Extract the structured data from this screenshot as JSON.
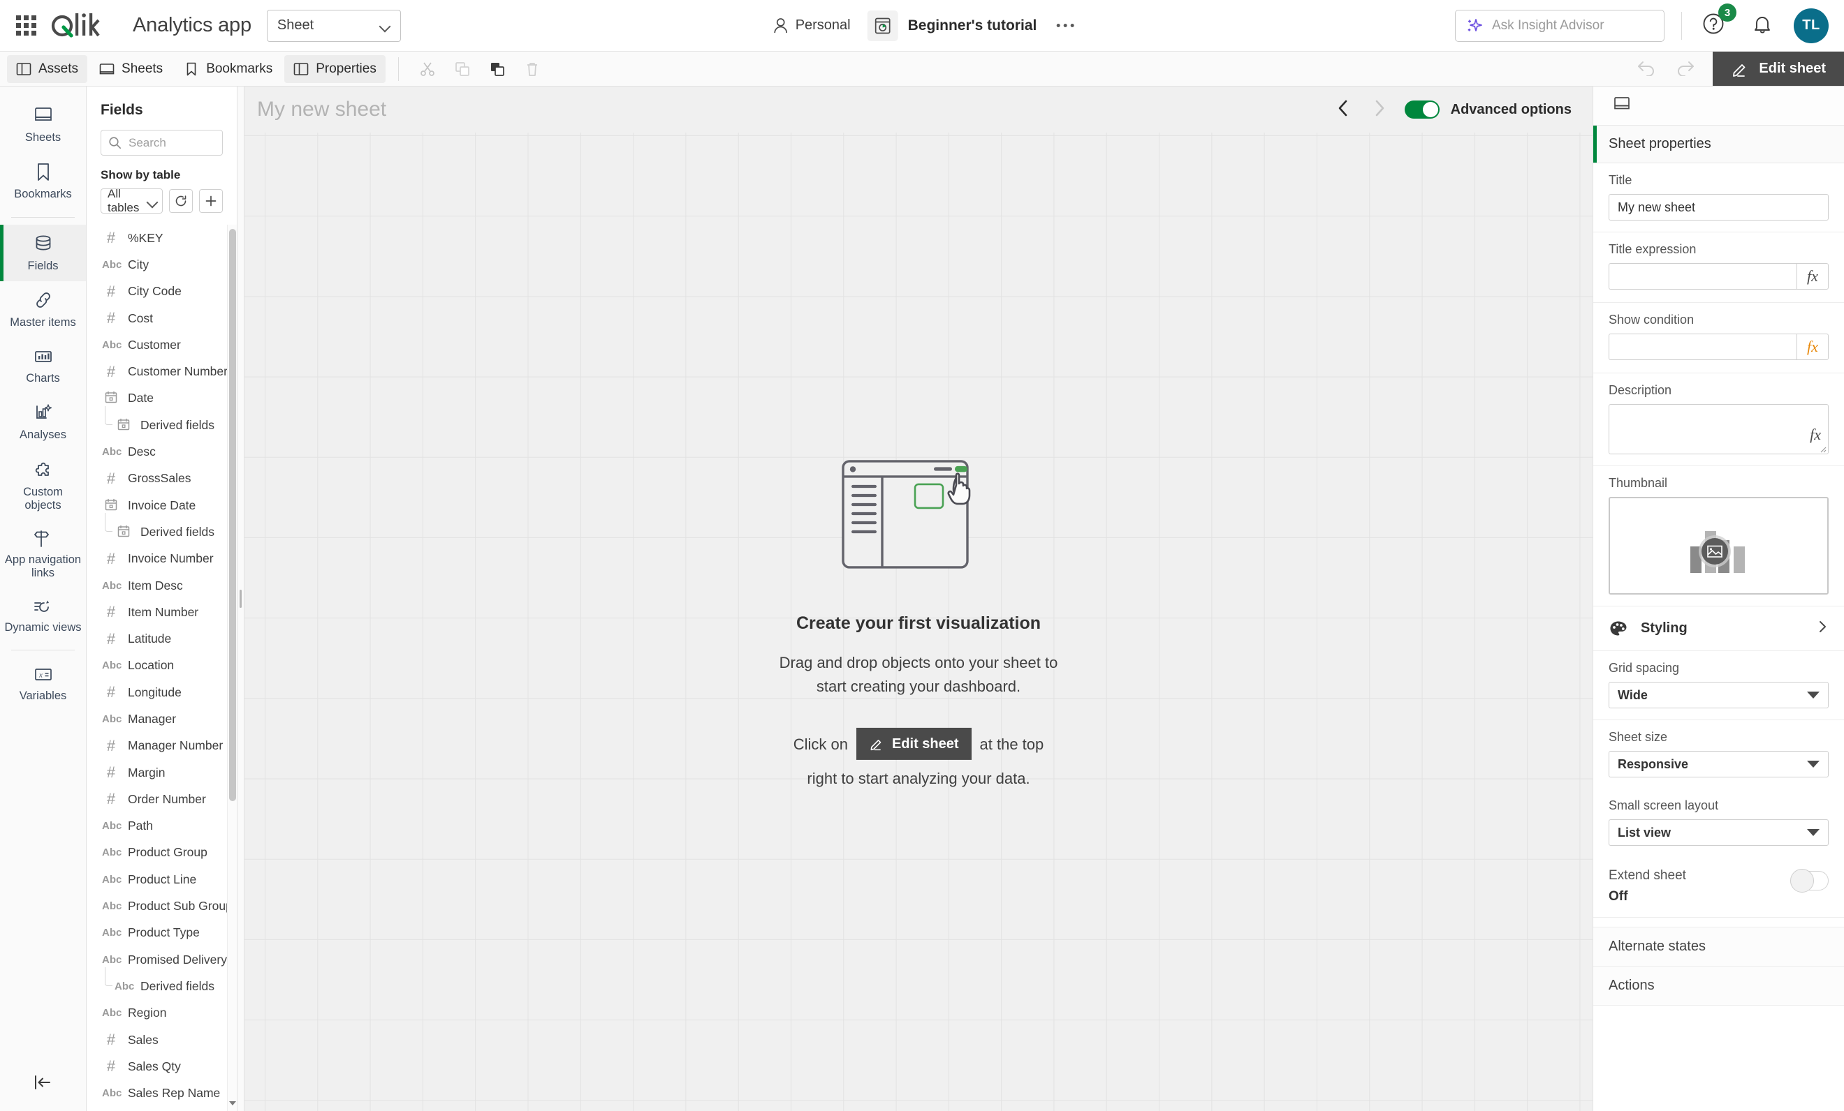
{
  "header": {
    "waffle_icon": "apps-grid-icon",
    "logo_text": "Qlik",
    "app_title": "Analytics app",
    "sheet_selector": {
      "value": "Sheet",
      "chevron": "chevron-down-icon"
    },
    "personal": {
      "label": "Personal",
      "icon": "person-icon"
    },
    "space": {
      "label": "Beginner's tutorial",
      "icon": "app-icon"
    },
    "overflow": "more-options-icon",
    "insight": {
      "placeholder": "Ask Insight Advisor",
      "icon": "sparkle-icon"
    },
    "help": {
      "icon": "help-circle-icon",
      "badge": "3"
    },
    "notifications": {
      "icon": "bell-icon"
    },
    "avatar": {
      "initials": "TL",
      "color": "#0a6e8a"
    }
  },
  "toolbar": {
    "buttons": [
      {
        "label": "Assets",
        "icon": "panel-left-icon",
        "active": true
      },
      {
        "label": "Sheets",
        "icon": "sheet-icon",
        "active": false
      },
      {
        "label": "Bookmarks",
        "icon": "bookmark-icon",
        "active": false
      },
      {
        "label": "Properties",
        "icon": "panel-right-icon",
        "active": true
      }
    ],
    "icon_buttons": [
      "cut-icon",
      "copy-icon",
      "paste-icon",
      "trash-icon"
    ],
    "undo": "undo-icon",
    "redo": "redo-icon",
    "edit_sheet": {
      "label": "Edit sheet",
      "icon": "pencil-icon"
    }
  },
  "rail": {
    "items": [
      {
        "label": "Sheets",
        "icon": "sheet-icon",
        "active": false
      },
      {
        "label": "Bookmarks",
        "icon": "bookmark-icon",
        "active": false
      },
      {
        "label": "Fields",
        "icon": "database-icon",
        "active": true
      },
      {
        "label": "Master items",
        "icon": "link-icon",
        "active": false
      },
      {
        "label": "Charts",
        "icon": "bar-chart-icon",
        "active": false
      },
      {
        "label": "Analyses",
        "icon": "analyses-icon",
        "active": false
      },
      {
        "label": "Custom objects",
        "icon": "puzzle-icon",
        "active": false
      },
      {
        "label": "App navigation links",
        "icon": "flag-icon",
        "active": false
      },
      {
        "label": "Dynamic views",
        "icon": "dynamic-views-icon",
        "active": false
      },
      {
        "label": "Variables",
        "icon": "variable-icon",
        "active": false
      }
    ],
    "collapse": {
      "icon": "collapse-left-icon"
    }
  },
  "assets": {
    "title": "Fields",
    "search": {
      "placeholder": "Search",
      "icon": "search-icon",
      "value": ""
    },
    "show_by_table_label": "Show by table",
    "table_select": {
      "value": "All tables",
      "chevron": "chevron-down-icon"
    },
    "refresh_button": {
      "icon": "refresh-icon"
    },
    "add_button": {
      "icon": "plus-icon"
    },
    "fields": [
      {
        "name": "%KEY",
        "type": "#",
        "derived": false
      },
      {
        "name": "City",
        "type": "Abc",
        "derived": false
      },
      {
        "name": "City Code",
        "type": "#",
        "derived": false
      },
      {
        "name": "Cost",
        "type": "#",
        "derived": false
      },
      {
        "name": "Customer",
        "type": "Abc",
        "derived": false
      },
      {
        "name": "Customer Number",
        "type": "#",
        "derived": false
      },
      {
        "name": "Date",
        "type": "cal",
        "derived": false
      },
      {
        "name": "Derived fields",
        "type": "cal",
        "derived": true
      },
      {
        "name": "Desc",
        "type": "Abc",
        "derived": false
      },
      {
        "name": "GrossSales",
        "type": "#",
        "derived": false
      },
      {
        "name": "Invoice Date",
        "type": "cal",
        "derived": false
      },
      {
        "name": "Derived fields",
        "type": "cal",
        "derived": true
      },
      {
        "name": "Invoice Number",
        "type": "#",
        "derived": false
      },
      {
        "name": "Item Desc",
        "type": "Abc",
        "derived": false
      },
      {
        "name": "Item Number",
        "type": "#",
        "derived": false
      },
      {
        "name": "Latitude",
        "type": "#",
        "derived": false
      },
      {
        "name": "Location",
        "type": "Abc",
        "derived": false
      },
      {
        "name": "Longitude",
        "type": "#",
        "derived": false
      },
      {
        "name": "Manager",
        "type": "Abc",
        "derived": false
      },
      {
        "name": "Manager Number",
        "type": "#",
        "derived": false
      },
      {
        "name": "Margin",
        "type": "#",
        "derived": false
      },
      {
        "name": "Order Number",
        "type": "#",
        "derived": false
      },
      {
        "name": "Path",
        "type": "Abc",
        "derived": false
      },
      {
        "name": "Product Group",
        "type": "Abc",
        "derived": false
      },
      {
        "name": "Product Line",
        "type": "Abc",
        "derived": false
      },
      {
        "name": "Product Sub Group",
        "type": "Abc",
        "derived": false
      },
      {
        "name": "Product Type",
        "type": "Abc",
        "derived": false
      },
      {
        "name": "Promised Delivery Date",
        "type": "Abc",
        "derived": false
      },
      {
        "name": "Derived fields",
        "type": "Abc",
        "derived": true
      },
      {
        "name": "Region",
        "type": "Abc",
        "derived": false
      },
      {
        "name": "Sales",
        "type": "#",
        "derived": false
      },
      {
        "name": "Sales Qty",
        "type": "#",
        "derived": false
      },
      {
        "name": "Sales Rep Name",
        "type": "Abc",
        "derived": false
      }
    ]
  },
  "canvas": {
    "sheet_name": "My new sheet",
    "prev_icon": "chevron-left-icon",
    "next_icon": "chevron-right-icon",
    "advanced_options": {
      "label": "Advanced options",
      "on": true,
      "color": "#00873d"
    },
    "empty_state": {
      "illustration": "drag-and-drop-illustration",
      "heading": "Create your first visualization",
      "paragraph_line1": "Drag and drop objects onto your sheet to",
      "paragraph_line2": "start creating your dashboard.",
      "cta_prefix": "Click on",
      "cta_chip": {
        "label": "Edit sheet",
        "icon": "pencil-icon"
      },
      "cta_suffix": "at the top",
      "cta_line2": "right to start analyzing your data."
    }
  },
  "properties": {
    "tab_icon": "sheet-icon",
    "section_title": "Sheet properties",
    "title_label": "Title",
    "title_value": "My new sheet",
    "title_expression_label": "Title expression",
    "title_expression_value": "",
    "show_condition_label": "Show condition",
    "show_condition_value": "",
    "description_label": "Description",
    "description_value": "",
    "thumbnail_label": "Thumbnail",
    "thumbnail_icon": "image-placeholder-icon",
    "styling": {
      "label": "Styling",
      "icon": "palette-icon",
      "chevron": "chevron-right-icon"
    },
    "grid_spacing_label": "Grid spacing",
    "grid_spacing_value": "Wide",
    "sheet_size_label": "Sheet size",
    "sheet_size_value": "Responsive",
    "small_screen_label": "Small screen layout",
    "small_screen_value": "List view",
    "extend_sheet_label": "Extend sheet",
    "extend_sheet_state": "Off",
    "alternate_states_label": "Alternate states",
    "actions_label": "Actions",
    "fx_label": "fx"
  }
}
